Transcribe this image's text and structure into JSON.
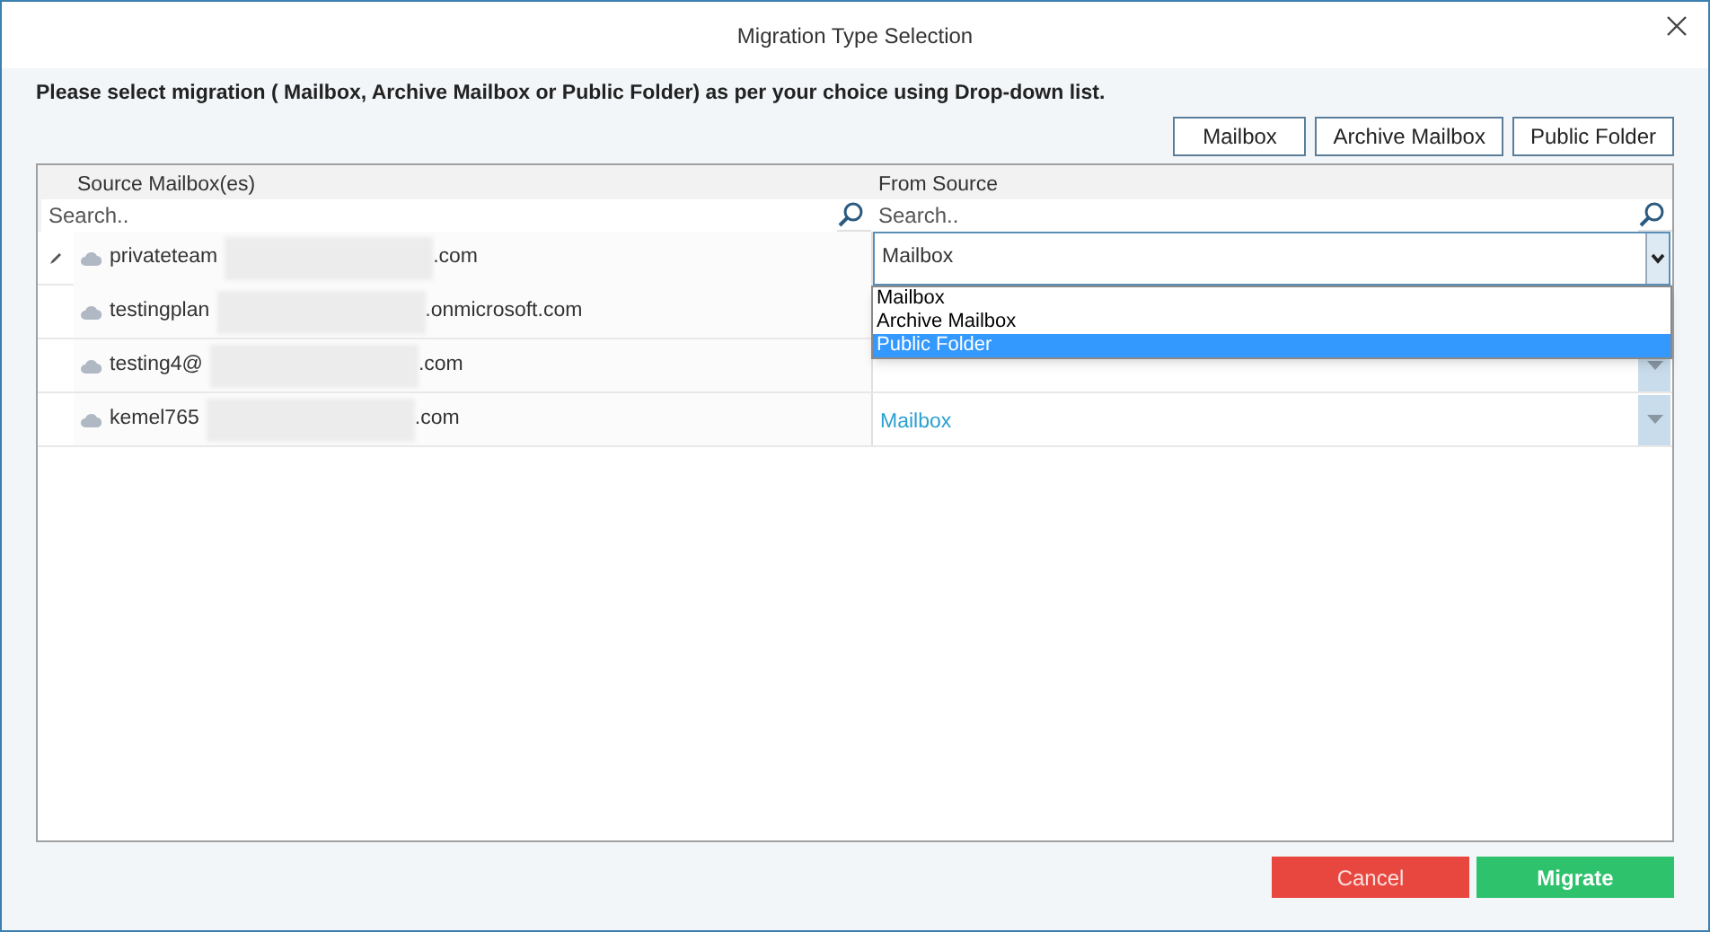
{
  "window": {
    "title": "Migration Type Selection"
  },
  "instruction": "Please select migration ( Mailbox, Archive Mailbox or Public Folder) as per your choice using Drop-down list.",
  "quick_buttons": [
    "Mailbox",
    "Archive Mailbox",
    "Public Folder"
  ],
  "table": {
    "columns": [
      {
        "title": "Source Mailbox(es)",
        "search_placeholder": "Search.."
      },
      {
        "title": "From Source",
        "search_placeholder": "Search.."
      }
    ],
    "rows": [
      {
        "kind": "editing",
        "email_start": "privateteam",
        "email_end": ".com",
        "from_source": "Mailbox",
        "options": [
          {
            "label": "Mailbox",
            "selected": false
          },
          {
            "label": "Archive Mailbox",
            "selected": false
          },
          {
            "label": "Public Folder",
            "selected": true
          }
        ]
      },
      {
        "kind": "hidden",
        "email_start": "testingplan",
        "email_end": ".onmicrosoft.com"
      },
      {
        "kind": "normal",
        "email_start": "testing4@",
        "email_end": ".com"
      },
      {
        "kind": "normal",
        "email_start": "kemel765",
        "email_end": ".com",
        "from_source": "Mailbox"
      }
    ]
  },
  "footer_buttons": [
    {
      "kind": "cancel",
      "label": "Cancel"
    },
    {
      "kind": "primary",
      "label": "Migrate"
    }
  ]
}
